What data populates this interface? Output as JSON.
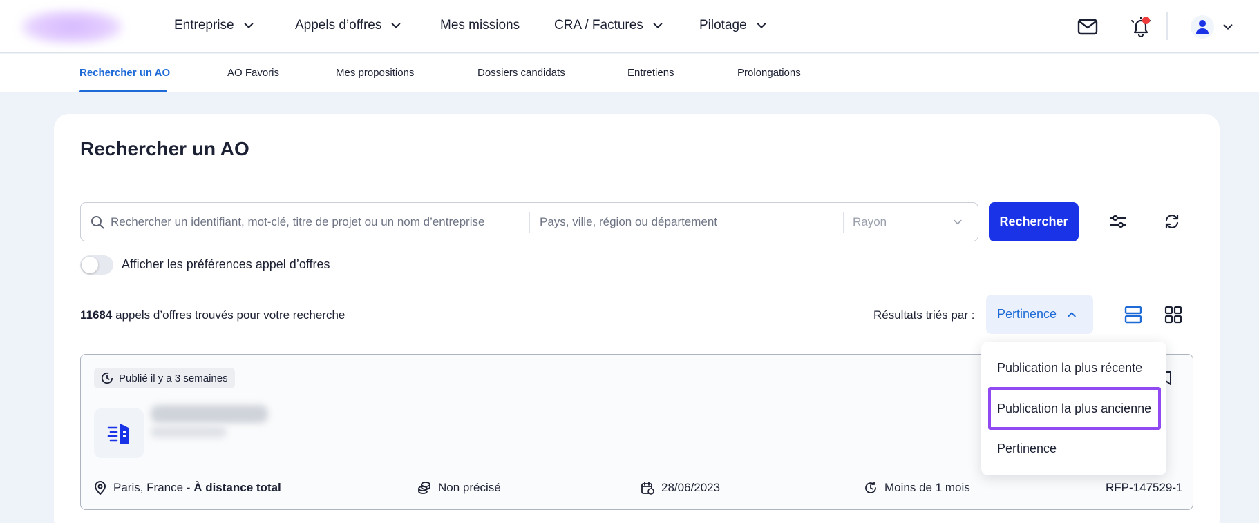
{
  "nav": {
    "items": [
      {
        "label": "Entreprise",
        "has_chevron": true
      },
      {
        "label": "Appels d’offres",
        "has_chevron": true
      },
      {
        "label": "Mes missions",
        "has_chevron": false
      },
      {
        "label": "CRA / Factures",
        "has_chevron": true
      },
      {
        "label": "Pilotage",
        "has_chevron": true
      }
    ],
    "icons": [
      "mail-icon",
      "bell-icon",
      "user-icon",
      "chevron-down-icon"
    ]
  },
  "subtabs": {
    "items": [
      "Rechercher un AO",
      "AO Favoris",
      "Mes propositions",
      "Dossiers candidats",
      "Entretiens",
      "Prolongations"
    ],
    "active": "Rechercher un AO"
  },
  "page": {
    "title": "Rechercher un AO"
  },
  "search": {
    "keyword_placeholder": "Rechercher un identifiant, mot-clé, titre de projet ou un nom d’entreprise",
    "location_placeholder": "Pays, ville, région ou département",
    "radius_placeholder": "Rayon",
    "button_label": "Rechercher"
  },
  "preferences": {
    "toggle_label": "Afficher les préférences appel d’offres",
    "enabled": false
  },
  "results": {
    "count": "11684",
    "count_suffix": " appels d’offres trouvés pour votre recherche",
    "sort_label": "Résultats triés par :",
    "sort_value": "Pertinence"
  },
  "sort_dropdown": {
    "options": [
      "Publication la plus récente",
      "Publication la plus ancienne",
      "Pertinence"
    ],
    "highlighted": "Publication la plus ancienne"
  },
  "result_card": {
    "published": "Publié il y a 3 semaines",
    "location": "Paris, France - ",
    "remote": "À distance total",
    "budget": "Non précisé",
    "date": "28/06/2023",
    "duration": "Moins de 1 mois",
    "reference": "RFP-147529-1"
  },
  "colors": {
    "primary": "#1a33e6",
    "accent_link": "#1e6ad6",
    "highlight": "#9149f2",
    "notification": "#ef3b3b"
  }
}
